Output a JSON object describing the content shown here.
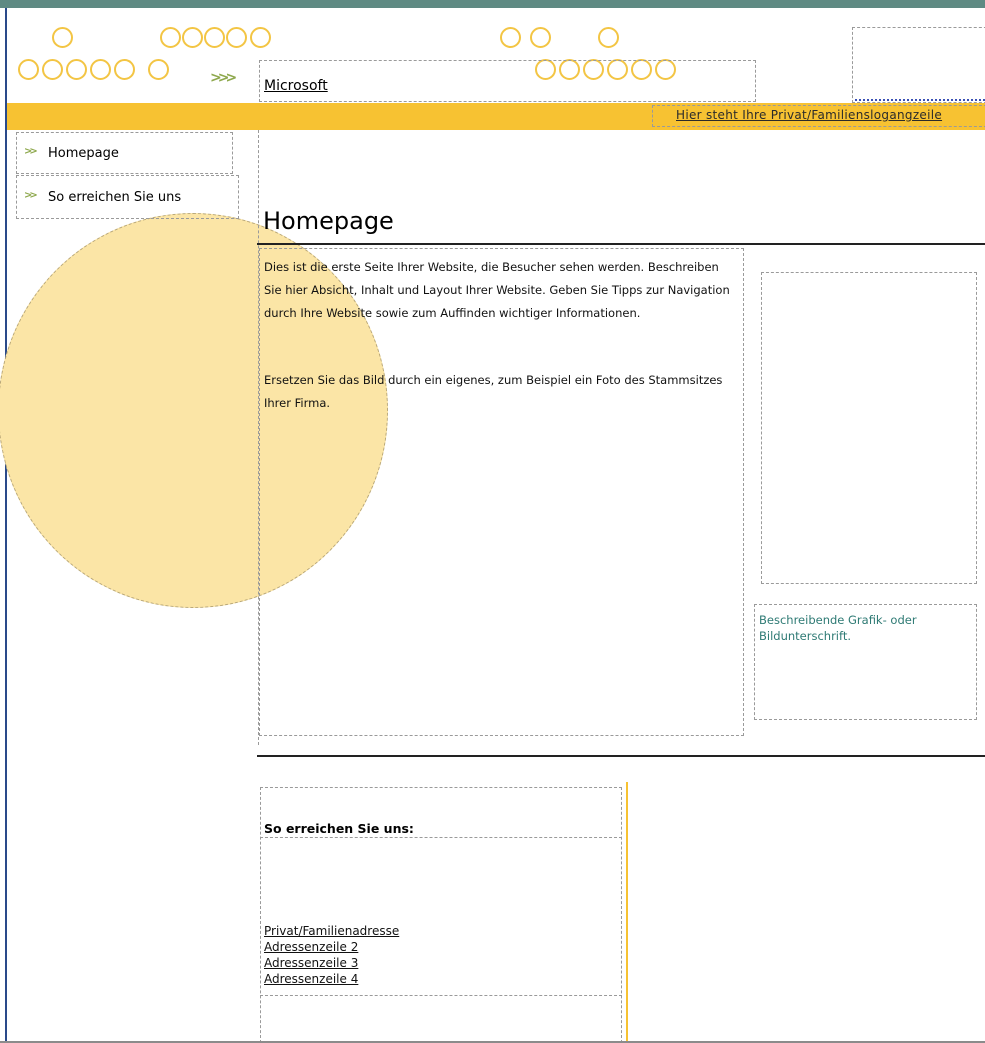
{
  "header": {
    "brand": "Microsoft",
    "slogan": "Hier steht Ihre Privat/Familienslogangzeile"
  },
  "nav": {
    "items": [
      {
        "label": "Homepage",
        "icon": "chevron-arrows-icon"
      },
      {
        "label": "So erreichen Sie uns",
        "icon": "chevron-arrows-icon"
      }
    ]
  },
  "main": {
    "title": "Homepage",
    "paragraphs": [
      "Dies ist die erste Seite Ihrer Website, die Besucher sehen werden. Beschreiben Sie hier Absicht, Inhalt und Layout Ihrer Website. Geben Sie Tipps zur Navigation durch Ihre Website sowie zum Auffinden wichtiger Informationen.",
      "Ersetzen Sie das Bild durch ein eigenes, zum Beispiel ein Foto des Stammsitzes Ihrer Firma."
    ],
    "caption": "Beschreibende Grafik- oder Bildunterschrift."
  },
  "contact": {
    "heading": "So erreichen Sie uns:",
    "address": [
      "Privat/Familienadresse",
      "Adressenzeile 2",
      "Adressenzeile 3",
      "Adressenzeile 4"
    ]
  },
  "colors": {
    "accent_yellow": "#f7c232",
    "teal_bar": "#5f8a83",
    "circle_fill": "#fbe5a6",
    "caption_text": "#2e7a74",
    "arrow_green": "#8ea84d"
  }
}
